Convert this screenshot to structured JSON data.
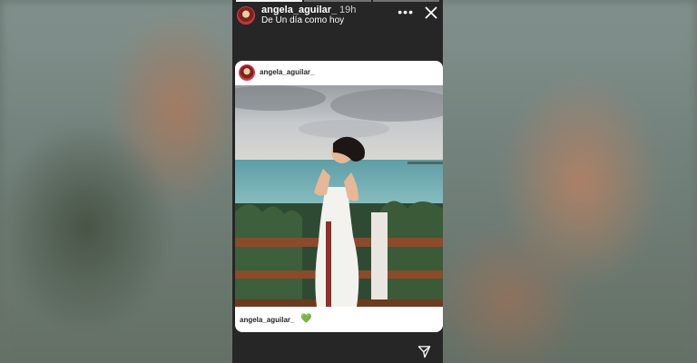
{
  "story": {
    "username": "angela_aguilar_",
    "time_ago": "19h",
    "caption": "De Un día como hoy",
    "progress_segments": 3,
    "current_segment": 1
  },
  "shared_post": {
    "username": "angela_aguilar_",
    "footer_username": "angela_aguilar_",
    "footer_emoji": "💚"
  },
  "icons": {
    "more": "more-options-icon",
    "close": "close-icon",
    "send": "send-icon"
  },
  "colors": {
    "story_background": "#262626",
    "avatar_ring": "#e1306c",
    "heart": "#2e9b3e"
  }
}
